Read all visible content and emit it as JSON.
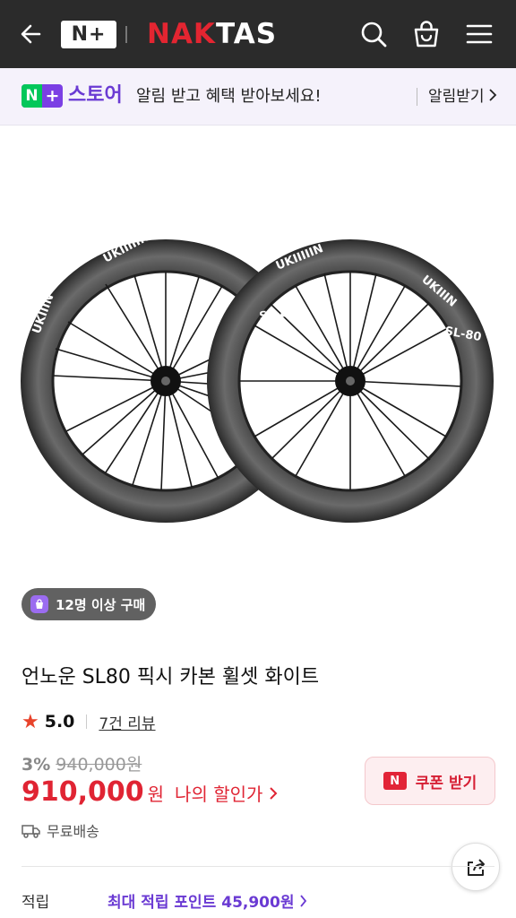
{
  "header": {
    "logo_badge": "N+",
    "brand_red": "NAK",
    "brand_white": "TAS",
    "icons": [
      "back-arrow-icon",
      "search-icon",
      "shopping-bag-icon",
      "menu-icon"
    ],
    "bg_color": "#2b2b2b",
    "brand_color": "#e32531"
  },
  "store_banner": {
    "badge_n": "N",
    "badge_plus": "+",
    "store_label": "스토어",
    "message": "알림 받고 혜택 받아보세요!",
    "action_label": "알림받기",
    "accent_color": "#6a3ad3"
  },
  "product": {
    "purchase_badge": "12명 이상 구매",
    "title": "언노운 SL80 픽시 카본 휠셋 화이트",
    "rating": "5.0",
    "review_link": "7건 리뷰",
    "discount_percent": "3%",
    "original_price": "940,000원",
    "price": "910,000",
    "price_unit": "원",
    "my_discount_link": "나의 할인가",
    "coupon_icon_text": "N",
    "coupon_button": "쿠폰 받기",
    "shipping": "무료배송",
    "points_label": "적립",
    "points_value": "최대 적립 포인트 45,900원",
    "price_color": "#e02433"
  }
}
